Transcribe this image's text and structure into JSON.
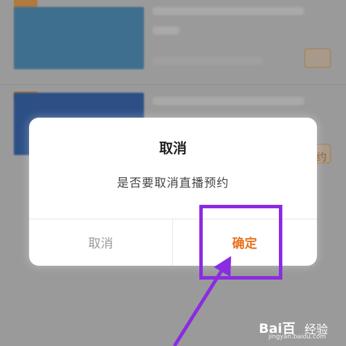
{
  "dialog": {
    "title": "取消",
    "message": "是否要取消直播预约",
    "cancel_label": "取消",
    "confirm_label": "确定"
  },
  "background": {
    "chip_text": "约"
  },
  "watermark": {
    "logo": "Bai百",
    "label": "经验",
    "site": "jingyan.baidu.com"
  },
  "colors": {
    "confirm_accent": "#e8701a",
    "annotation": "#8b2be2",
    "cancel_text": "#999999"
  }
}
